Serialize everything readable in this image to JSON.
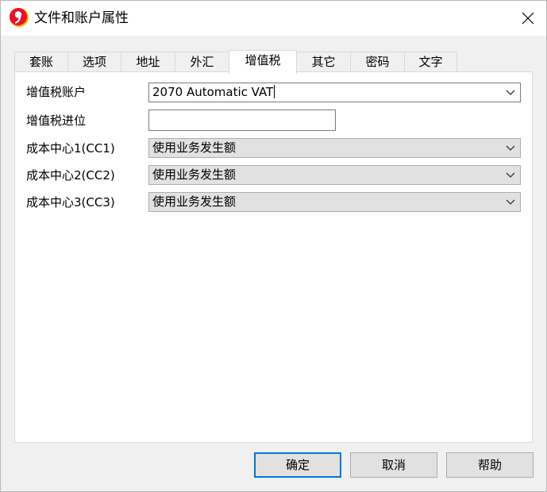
{
  "window": {
    "title": "文件和账户属性",
    "app_icon": "nine-logo-icon",
    "close_icon": "close-icon"
  },
  "tabs": [
    {
      "label": "套账",
      "active": false
    },
    {
      "label": "选项",
      "active": false
    },
    {
      "label": "地址",
      "active": false
    },
    {
      "label": "外汇",
      "active": false
    },
    {
      "label": "增值税",
      "active": true
    },
    {
      "label": "其它",
      "active": false
    },
    {
      "label": "密码",
      "active": false
    },
    {
      "label": "文字",
      "active": false
    }
  ],
  "form": {
    "vat_account": {
      "label": "增值税账户",
      "value": "2070 Automatic VAT"
    },
    "vat_rounding": {
      "label": "增值税进位",
      "value": ""
    },
    "cc1": {
      "label": "成本中心1(CC1)",
      "value": "使用业务发生额"
    },
    "cc2": {
      "label": "成本中心2(CC2)",
      "value": "使用业务发生额"
    },
    "cc3": {
      "label": "成本中心3(CC3)",
      "value": "使用业务发生额"
    }
  },
  "buttons": {
    "ok": "确定",
    "cancel": "取消",
    "help": "帮助"
  },
  "colors": {
    "logo_red": "#e8112d",
    "logo_yellow": "#f7b500",
    "focus_border": "#0078d7"
  }
}
